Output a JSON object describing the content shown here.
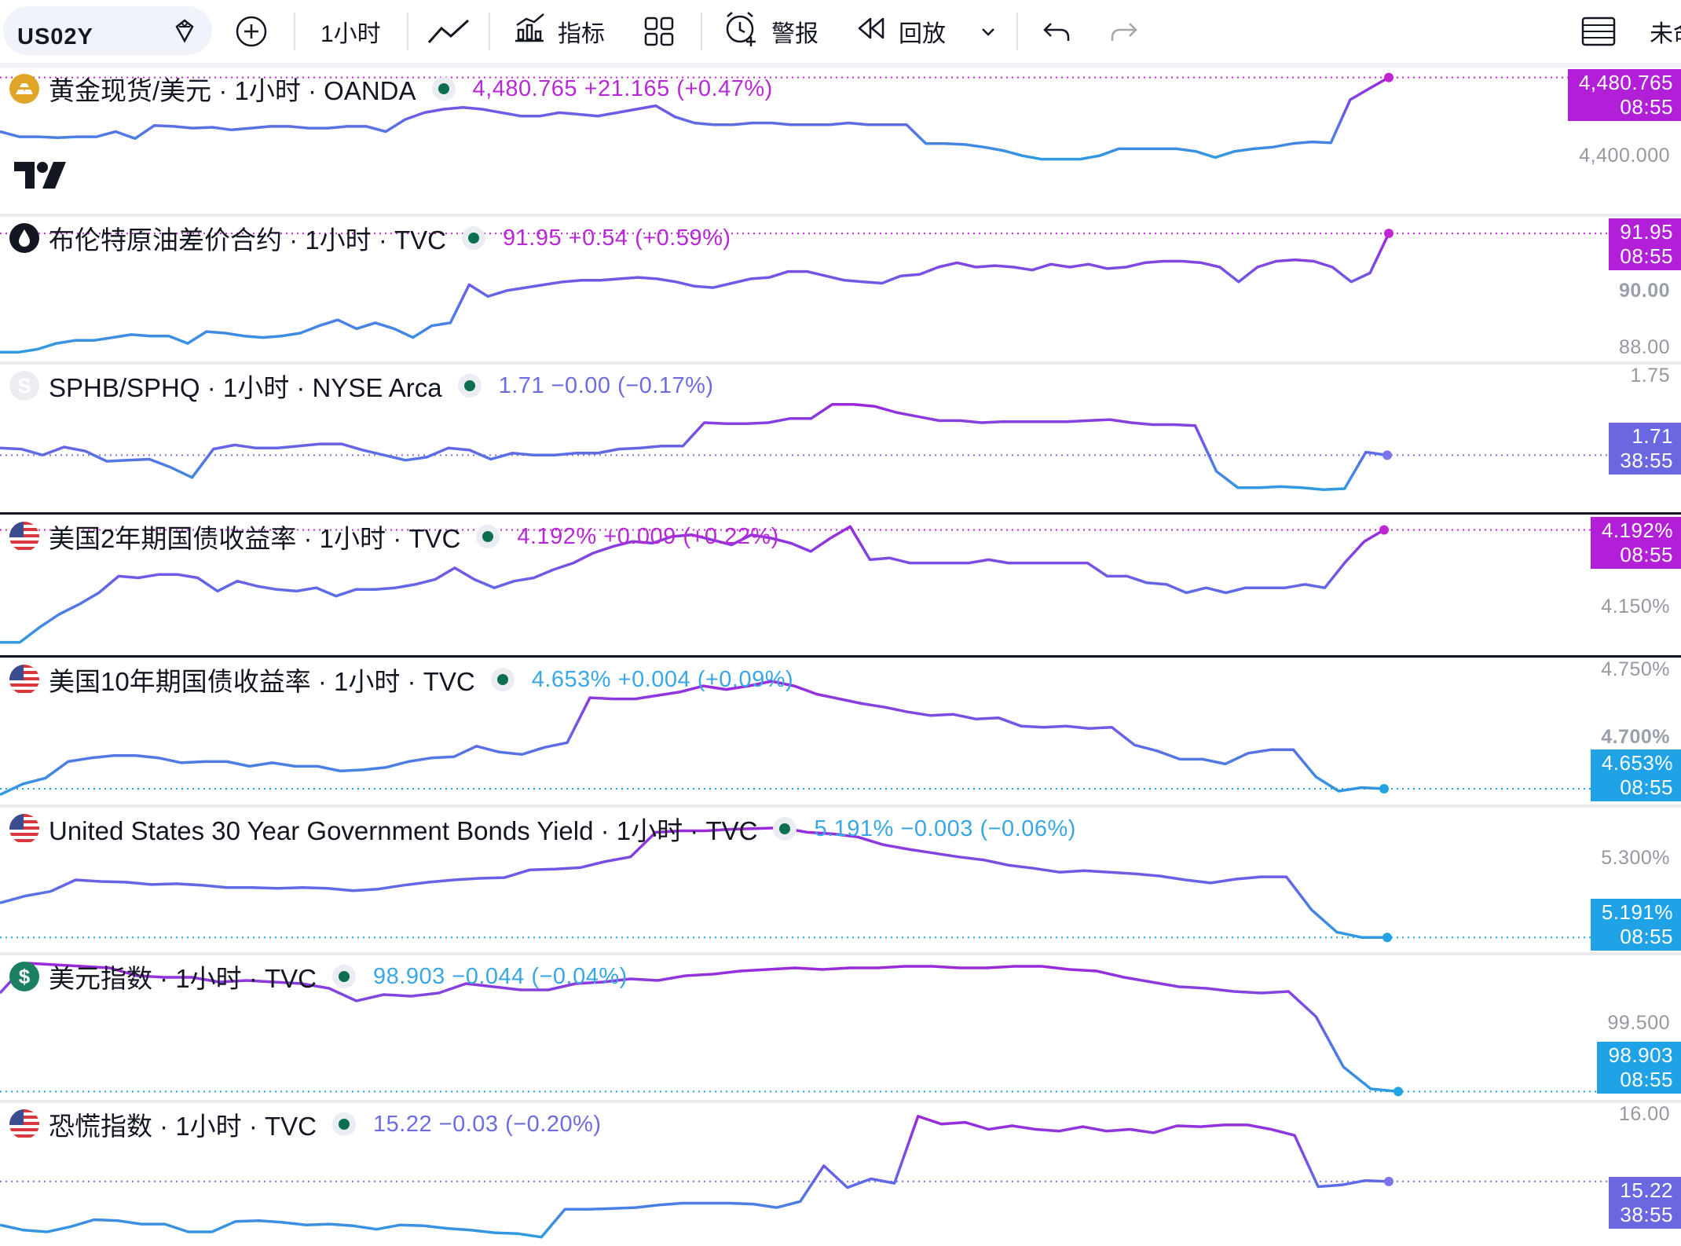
{
  "toolbar": {
    "symbol": "US02Y",
    "interval": "1小时",
    "indicators_label": "指标",
    "alert_label": "警报",
    "replay_label": "回放",
    "right_text": "未命"
  },
  "colors": {
    "magenta": "#9c27d9",
    "blue": "#2f9be0",
    "violet": "#6b5fe6",
    "tag_magenta": "#b11fd6",
    "tag_blue": "#20a3e6",
    "tag_violet": "#6a67e0"
  },
  "chart_data": [
    {
      "type": "line",
      "title": "黄金现货/美元 · 1小时 · OANDA",
      "value_text": "4,480.765  +21.165 (+0.47%)",
      "price_tag": "4,480.765",
      "countdown": "08:55",
      "axis_ticks": [
        "4,400.000"
      ],
      "icon": "gold-bars-icon",
      "ylim": [
        4330,
        4485
      ],
      "values": [
        4418,
        4412,
        4412,
        4411,
        4412,
        4412,
        4418,
        4410,
        4425,
        4424,
        4422,
        4423,
        4420,
        4422,
        4424,
        4424,
        4422,
        4422,
        4424,
        4424,
        4418,
        4432,
        4440,
        4444,
        4446,
        4444,
        4440,
        4436,
        4436,
        4440,
        4438,
        4436,
        4440,
        4444,
        4448,
        4435,
        4428,
        4426,
        4426,
        4428,
        4428,
        4426,
        4426,
        4426,
        4428,
        4426,
        4426,
        4426,
        4404,
        4404,
        4403,
        4400,
        4396,
        4390,
        4386,
        4386,
        4386,
        4390,
        4398,
        4398,
        4398,
        4398,
        4395,
        4388,
        4395,
        4398,
        4400,
        4404,
        4406,
        4405,
        4455,
        4468,
        4480.765
      ]
    },
    {
      "type": "line",
      "title": "布伦特原油差价合约 · 1小时 · TVC",
      "value_text": "91.95  +0.54 (+0.59%)",
      "price_tag": "91.95",
      "countdown": "08:55",
      "axis_ticks": [
        "90.00",
        "88.00"
      ],
      "icon": "oil-drop-icon",
      "ylim": [
        87.8,
        92.3
      ],
      "values": [
        87.9,
        87.9,
        88.0,
        88.2,
        88.3,
        88.3,
        88.4,
        88.5,
        88.45,
        88.45,
        88.2,
        88.6,
        88.55,
        88.45,
        88.4,
        88.45,
        88.55,
        88.8,
        89.0,
        88.7,
        88.9,
        88.7,
        88.4,
        88.8,
        88.9,
        90.2,
        89.8,
        90.0,
        90.1,
        90.2,
        90.3,
        90.35,
        90.35,
        90.4,
        90.45,
        90.4,
        90.3,
        90.15,
        90.1,
        90.25,
        90.4,
        90.45,
        90.65,
        90.65,
        90.5,
        90.35,
        90.3,
        90.25,
        90.5,
        90.55,
        90.8,
        90.95,
        90.8,
        90.85,
        90.8,
        90.7,
        90.9,
        90.8,
        90.9,
        90.75,
        90.8,
        90.95,
        91.0,
        91.0,
        90.95,
        90.8,
        90.3,
        90.8,
        91.0,
        91.05,
        91.0,
        90.8,
        90.3,
        90.6,
        91.95
      ]
    },
    {
      "type": "line",
      "title": "SPHB/SPHQ · 1小时 · NYSE Arca",
      "value_text": "1.71  −0.00 (−0.17%)",
      "price_tag": "1.71",
      "countdown": "38:55",
      "axis_ticks": [
        "1.75"
      ],
      "icon": "s-letter-icon",
      "ylim": [
        1.685,
        1.7515
      ],
      "values": [
        1.7135,
        1.713,
        1.71,
        1.714,
        1.712,
        1.707,
        1.7075,
        1.708,
        1.704,
        1.699,
        1.713,
        1.715,
        1.7135,
        1.7135,
        1.7145,
        1.7155,
        1.7155,
        1.7125,
        1.71,
        1.7075,
        1.709,
        1.7135,
        1.7125,
        1.708,
        1.711,
        1.71,
        1.71,
        1.711,
        1.711,
        1.713,
        1.7135,
        1.7145,
        1.7145,
        1.726,
        1.7255,
        1.7255,
        1.726,
        1.728,
        1.728,
        1.735,
        1.735,
        1.734,
        1.731,
        1.729,
        1.727,
        1.727,
        1.726,
        1.7265,
        1.7265,
        1.7265,
        1.7265,
        1.727,
        1.7275,
        1.726,
        1.725,
        1.725,
        1.7245,
        1.702,
        1.694,
        1.694,
        1.6945,
        1.694,
        1.693,
        1.6935,
        1.7115,
        1.71
      ]
    },
    {
      "type": "line",
      "title": "美国2年期国债收益率 · 1小时 · TVC",
      "value_text": "4.192%  +0.009 (+0.22%)",
      "price_tag": "4.192%",
      "countdown": "08:55",
      "axis_ticks": [
        "4.150%"
      ],
      "icon": "us-flag-icon",
      "ylim": [
        4.12,
        4.197
      ],
      "values": [
        4.124,
        4.124,
        4.133,
        4.141,
        4.147,
        4.154,
        4.164,
        4.163,
        4.165,
        4.165,
        4.163,
        4.155,
        4.161,
        4.158,
        4.156,
        4.155,
        4.157,
        4.152,
        4.156,
        4.156,
        4.157,
        4.159,
        4.162,
        4.169,
        4.162,
        4.157,
        4.161,
        4.163,
        4.168,
        4.172,
        4.178,
        4.182,
        4.185,
        4.184,
        4.188,
        4.189,
        4.186,
        4.183,
        4.189,
        4.187,
        4.184,
        4.179,
        4.187,
        4.194,
        4.174,
        4.175,
        4.172,
        4.172,
        4.172,
        4.172,
        4.174,
        4.172,
        4.172,
        4.172,
        4.172,
        4.172,
        4.164,
        4.164,
        4.16,
        4.159,
        4.154,
        4.157,
        4.154,
        4.157,
        4.157,
        4.157,
        4.159,
        4.157,
        4.172,
        4.185,
        4.192
      ]
    },
    {
      "type": "line",
      "title": "美国10年期国债收益率 · 1小时 · TVC",
      "value_text": "4.653%  +0.004 (+0.09%)",
      "price_tag": "4.653%",
      "countdown": "08:55",
      "axis_ticks": [
        "4.750%",
        "4.700%"
      ],
      "icon": "us-flag-icon",
      "ylim": [
        4.645,
        4.758
      ],
      "values": [
        4.648,
        4.657,
        4.662,
        4.676,
        4.679,
        4.681,
        4.681,
        4.679,
        4.675,
        4.676,
        4.676,
        4.672,
        4.675,
        4.672,
        4.672,
        4.668,
        4.669,
        4.671,
        4.676,
        4.679,
        4.68,
        4.689,
        4.684,
        4.682,
        4.688,
        4.692,
        4.73,
        4.729,
        4.729,
        4.732,
        4.735,
        4.74,
        4.737,
        4.74,
        4.744,
        4.74,
        4.733,
        4.729,
        4.725,
        4.722,
        4.718,
        4.715,
        4.716,
        4.712,
        4.713,
        4.706,
        4.705,
        4.706,
        4.704,
        4.705,
        4.69,
        4.685,
        4.678,
        4.678,
        4.674,
        4.683,
        4.686,
        4.686,
        4.663,
        4.651,
        4.654,
        4.653
      ]
    },
    {
      "type": "line",
      "title": "United States 30 Year Government Bonds Yield · 1小时 · TVC",
      "value_text": "5.191%  −0.003 (−0.06%)",
      "price_tag": "5.191%",
      "countdown": "08:55",
      "axis_ticks": [
        "5.300%"
      ],
      "icon": "us-flag-icon",
      "ylim": [
        5.18,
        5.352
      ],
      "values": [
        5.236,
        5.245,
        5.251,
        5.266,
        5.264,
        5.263,
        5.26,
        5.261,
        5.259,
        5.256,
        5.256,
        5.255,
        5.256,
        5.255,
        5.252,
        5.254,
        5.259,
        5.263,
        5.266,
        5.268,
        5.269,
        5.279,
        5.28,
        5.282,
        5.29,
        5.296,
        5.328,
        5.33,
        5.33,
        5.332,
        5.333,
        5.334,
        5.328,
        5.326,
        5.322,
        5.312,
        5.306,
        5.301,
        5.296,
        5.292,
        5.285,
        5.281,
        5.276,
        5.278,
        5.276,
        5.274,
        5.271,
        5.266,
        5.262,
        5.267,
        5.27,
        5.27,
        5.227,
        5.198,
        5.191,
        5.191
      ]
    },
    {
      "type": "line",
      "title": "美元指数 · 1小时 · TVC",
      "value_text": "98.903  −0.044 (−0.04%)",
      "price_tag": "98.903",
      "countdown": "08:55",
      "axis_ticks": [
        "99.500"
      ],
      "icon": "dollar-sign-icon",
      "ylim": [
        98.89,
        99.73
      ],
      "values": [
        99.53,
        99.72,
        99.71,
        99.7,
        99.69,
        99.64,
        99.63,
        99.63,
        99.6,
        99.61,
        99.6,
        99.59,
        99.56,
        99.48,
        99.52,
        99.51,
        99.53,
        99.59,
        99.57,
        99.55,
        99.55,
        99.59,
        99.6,
        99.62,
        99.61,
        99.64,
        99.65,
        99.67,
        99.68,
        99.69,
        99.68,
        99.69,
        99.69,
        99.7,
        99.7,
        99.69,
        99.69,
        99.7,
        99.7,
        99.68,
        99.67,
        99.63,
        99.6,
        99.57,
        99.56,
        99.54,
        99.53,
        99.54,
        99.38,
        99.06,
        98.92,
        98.903
      ]
    },
    {
      "type": "line",
      "title": "恐慌指数 · 1小时 · TVC",
      "value_text": "15.22  −0.03 (−0.20%)",
      "price_tag": "15.22",
      "countdown": "38:55",
      "axis_ticks": [
        "16.00"
      ],
      "icon": "us-flag-icon",
      "ylim": [
        14.55,
        16.05
      ],
      "values": [
        14.72,
        14.66,
        14.64,
        14.7,
        14.78,
        14.77,
        14.73,
        14.73,
        14.64,
        14.64,
        14.76,
        14.77,
        14.75,
        14.72,
        14.73,
        14.71,
        14.67,
        14.72,
        14.71,
        14.68,
        14.66,
        14.63,
        14.62,
        14.58,
        14.9,
        14.9,
        14.91,
        14.92,
        14.95,
        14.97,
        14.97,
        14.97,
        14.96,
        14.92,
        14.99,
        15.4,
        15.15,
        15.25,
        15.2,
        15.97,
        15.88,
        15.9,
        15.82,
        15.86,
        15.82,
        15.8,
        15.85,
        15.8,
        15.82,
        15.78,
        15.86,
        15.85,
        15.87,
        15.87,
        15.82,
        15.75,
        15.16,
        15.18,
        15.23,
        15.22
      ]
    }
  ]
}
